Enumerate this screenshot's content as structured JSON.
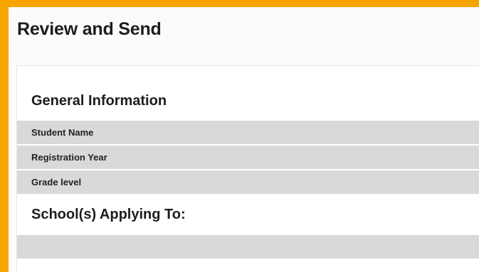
{
  "page": {
    "title": "Review and Send"
  },
  "general_information": {
    "heading": "General Information",
    "rows": [
      {
        "label": "Student Name"
      },
      {
        "label": "Registration Year"
      },
      {
        "label": "Grade level"
      }
    ]
  },
  "schools": {
    "heading": "School(s) Applying To:"
  },
  "colors": {
    "frame": "#f7a300",
    "row_background": "#d9d9dc"
  }
}
